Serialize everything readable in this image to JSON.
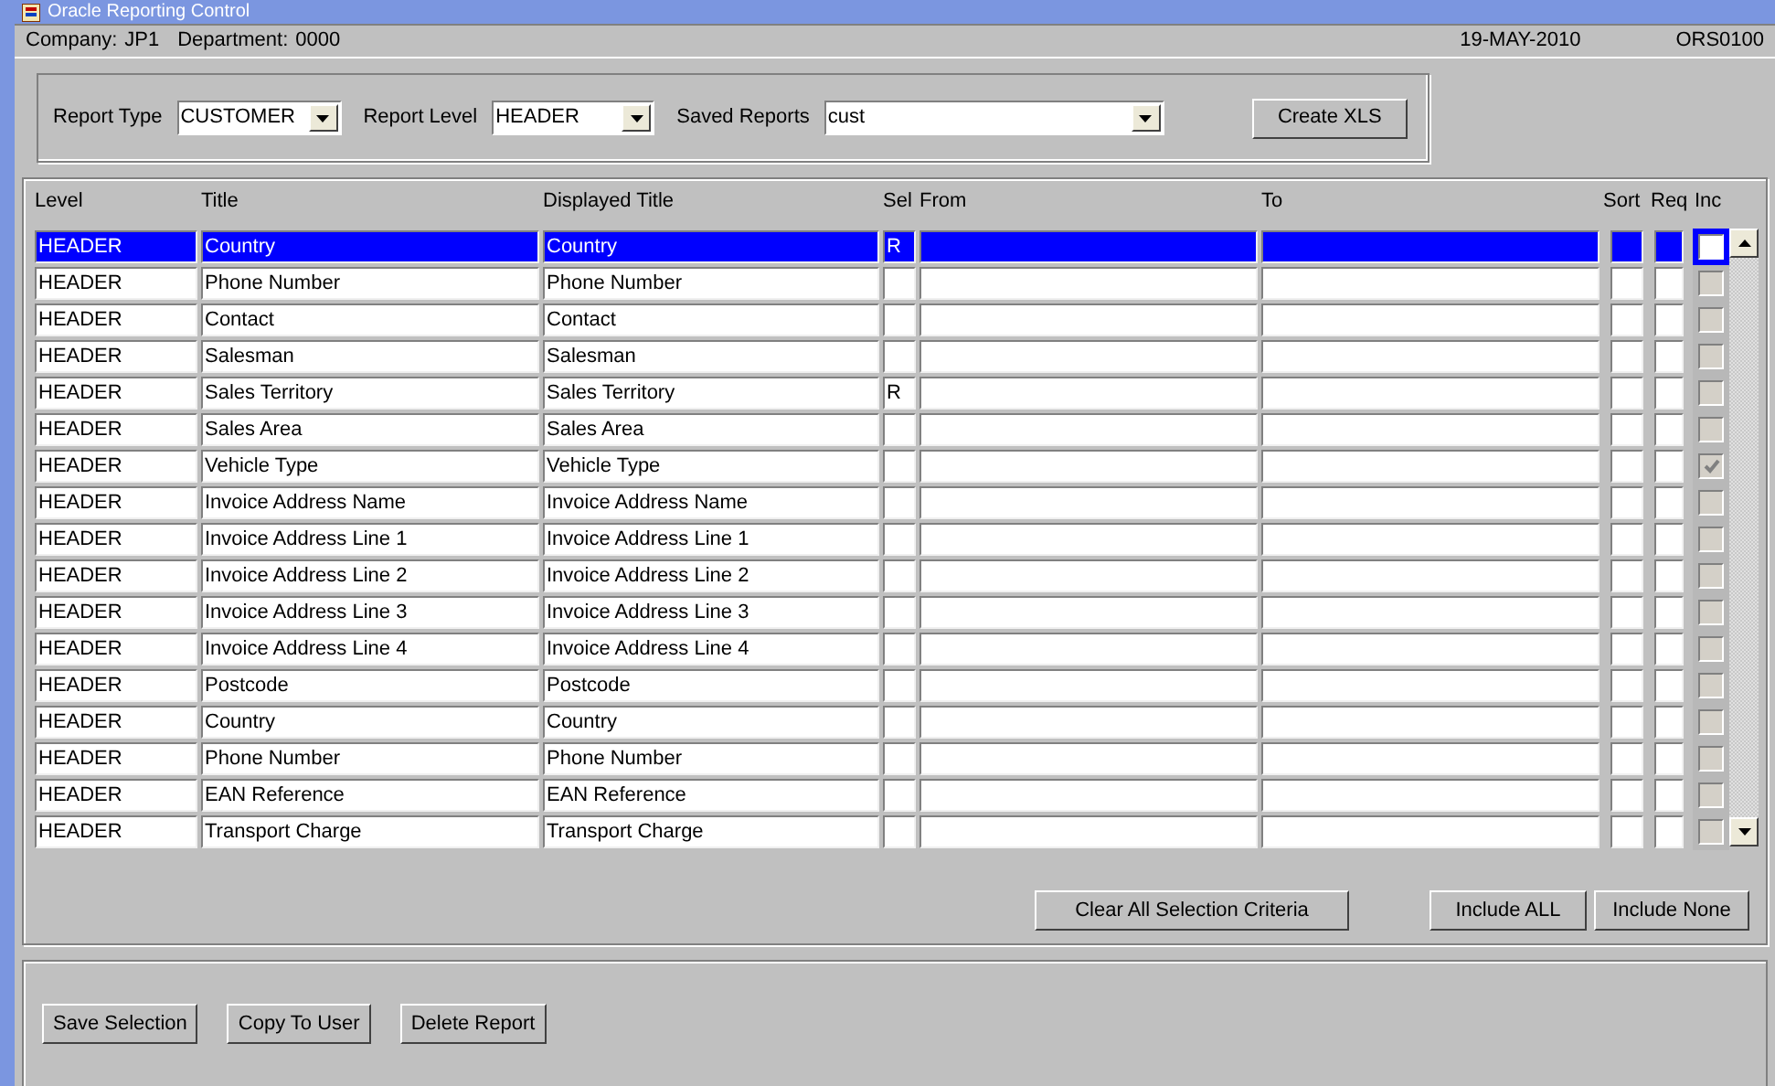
{
  "window": {
    "title": "Oracle Reporting Control"
  },
  "header": {
    "company_label": "Company:",
    "company": "JP1",
    "department_label": "Department:",
    "department": "0000",
    "date": "19-MAY-2010",
    "form_code": "ORS0100"
  },
  "filters": [
    {
      "label": "Report Type",
      "value": "CUSTOMER"
    },
    {
      "label": "Report Level",
      "value": "HEADER"
    },
    {
      "label": "Saved Reports",
      "value": "cust"
    }
  ],
  "create_button": "Create XLS",
  "table": {
    "columns": [
      "Level",
      "Title",
      "Displayed Title",
      "Sel",
      "From",
      "To",
      "Sort",
      "Req",
      "Inc"
    ],
    "rows": [
      {
        "level": "HEADER",
        "title": "Country",
        "displayed_title": "Country",
        "sel": "R",
        "inc": false,
        "selected": true
      },
      {
        "level": "HEADER",
        "title": "Phone Number",
        "displayed_title": "Phone Number",
        "inc": false,
        "selected": false
      },
      {
        "level": "HEADER",
        "title": "Contact",
        "displayed_title": "Contact",
        "inc": false,
        "selected": false
      },
      {
        "level": "HEADER",
        "title": "Salesman",
        "displayed_title": "Salesman",
        "inc": false,
        "selected": false
      },
      {
        "level": "HEADER",
        "title": "Sales Territory",
        "displayed_title": "Sales Territory",
        "sel": "R",
        "inc": false,
        "selected": false
      },
      {
        "level": "HEADER",
        "title": "Sales Area",
        "displayed_title": "Sales Area",
        "inc": false,
        "selected": false
      },
      {
        "level": "HEADER",
        "title": "Vehicle Type",
        "displayed_title": "Vehicle Type",
        "inc": true,
        "selected": false
      },
      {
        "level": "HEADER",
        "title": "Invoice Address Name",
        "displayed_title": "Invoice Address Name",
        "inc": false,
        "selected": false
      },
      {
        "level": "HEADER",
        "title": "Invoice Address Line 1",
        "displayed_title": "Invoice Address Line 1",
        "inc": false,
        "selected": false
      },
      {
        "level": "HEADER",
        "title": "Invoice Address Line 2",
        "displayed_title": "Invoice Address Line 2",
        "inc": false,
        "selected": false
      },
      {
        "level": "HEADER",
        "title": "Invoice Address Line 3",
        "displayed_title": "Invoice Address Line 3",
        "inc": false,
        "selected": false
      },
      {
        "level": "HEADER",
        "title": "Invoice Address Line 4",
        "displayed_title": "Invoice Address Line 4",
        "inc": false,
        "selected": false
      },
      {
        "level": "HEADER",
        "title": "Postcode",
        "displayed_title": "Postcode",
        "inc": false,
        "selected": false
      },
      {
        "level": "HEADER",
        "title": "Country",
        "displayed_title": "Country",
        "inc": false,
        "selected": false
      },
      {
        "level": "HEADER",
        "title": "Phone Number",
        "displayed_title": "Phone Number",
        "inc": false,
        "selected": false
      },
      {
        "level": "HEADER",
        "title": "EAN Reference",
        "displayed_title": "EAN Reference",
        "inc": false,
        "selected": false
      },
      {
        "level": "HEADER",
        "title": "Transport Charge",
        "displayed_title": "Transport Charge",
        "inc": false,
        "selected": false
      }
    ]
  },
  "table_buttons": [
    "Clear All Selection Criteria",
    "Include ALL",
    "Include None"
  ],
  "footer_buttons": [
    "Save Selection",
    "Copy To User",
    "Delete Report"
  ]
}
